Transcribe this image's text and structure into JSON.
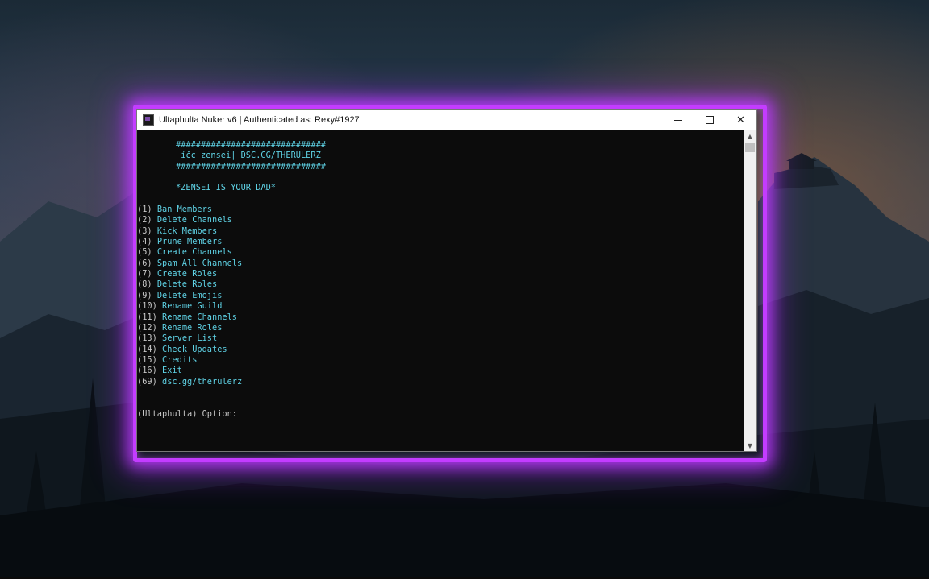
{
  "window": {
    "title": "Ultaphulta Nuker v6 | Authenticated as: Rexy#1927",
    "controls": {
      "minimize": "",
      "maximize": "",
      "close": "✕"
    }
  },
  "console": {
    "banner": [
      "##############################",
      " íčc zensei| DSC.GG/THERULERZ",
      "##############################",
      "",
      "*ZENSEI IS YOUR DAD*"
    ],
    "menu": [
      {
        "num": "(1)",
        "label": "Ban Members"
      },
      {
        "num": "(2)",
        "label": "Delete Channels"
      },
      {
        "num": "(3)",
        "label": "Kick Members"
      },
      {
        "num": "(4)",
        "label": "Prune Members"
      },
      {
        "num": "(5)",
        "label": "Create Channels"
      },
      {
        "num": "(6)",
        "label": "Spam All Channels"
      },
      {
        "num": "(7)",
        "label": "Create Roles"
      },
      {
        "num": "(8)",
        "label": "Delete Roles"
      },
      {
        "num": "(9)",
        "label": "Delete Emojis"
      },
      {
        "num": "(10)",
        "label": "Rename Guild"
      },
      {
        "num": "(11)",
        "label": "Rename Channels"
      },
      {
        "num": "(12)",
        "label": "Rename Roles"
      },
      {
        "num": "(13)",
        "label": "Server List"
      },
      {
        "num": "(14)",
        "label": "Check Updates"
      },
      {
        "num": "(15)",
        "label": "Credits"
      },
      {
        "num": "(16)",
        "label": "Exit"
      },
      {
        "num": "(69)",
        "label": "dsc.gg/therulerz"
      }
    ],
    "prompt": {
      "prefix": "(Ultaphulta)",
      "label": " Option:"
    }
  },
  "colors": {
    "glow": "#c33cff",
    "menu_text": "#5fd3e6",
    "console_bg": "#0c0c0c"
  }
}
